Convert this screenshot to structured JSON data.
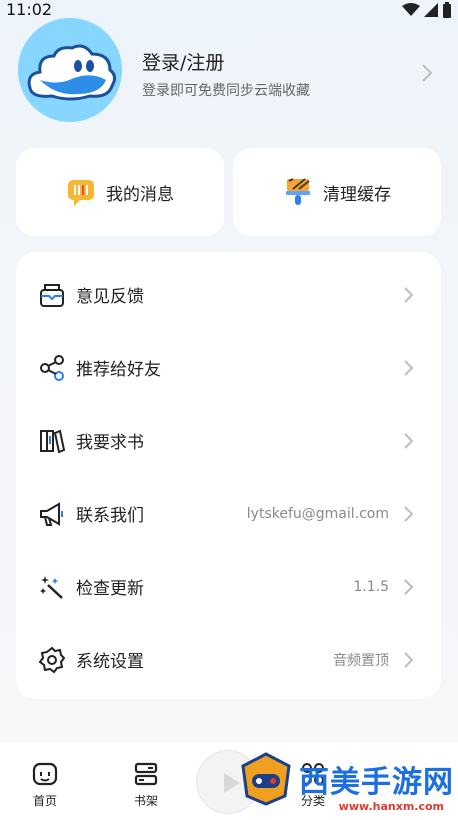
{
  "status_bar": {
    "time": "11:02"
  },
  "profile": {
    "title": "登录/注册",
    "subtitle": "登录即可免费同步云端收藏"
  },
  "quick_actions": [
    {
      "label": "我的消息",
      "icon": "message-icon"
    },
    {
      "label": "清理缓存",
      "icon": "brush-icon"
    }
  ],
  "menu": [
    {
      "label": "意见反馈",
      "value": "",
      "icon": "feedback-icon"
    },
    {
      "label": "推荐给好友",
      "value": "",
      "icon": "share-icon"
    },
    {
      "label": "我要求书",
      "value": "",
      "icon": "books-icon"
    },
    {
      "label": "联系我们",
      "value": "lytskefu@gmail.com",
      "icon": "megaphone-icon"
    },
    {
      "label": "检查更新",
      "value": "1.1.5",
      "icon": "magic-wand-icon"
    },
    {
      "label": "系统设置",
      "value": "音频置顶",
      "icon": "settings-icon"
    }
  ],
  "tabbar": {
    "items": [
      {
        "label": "首页",
        "icon": "home-icon"
      },
      {
        "label": "书架",
        "icon": "bookshelf-icon"
      },
      {
        "label": "分类",
        "icon": "category-icon"
      }
    ]
  },
  "watermark": {
    "text": "西美手游网",
    "sub": "www.hanxm.com"
  },
  "colors": {
    "accent": "#1c6fe0",
    "avatar_bg": "#7ed3ff",
    "page_bg": "#f4f6f9"
  }
}
